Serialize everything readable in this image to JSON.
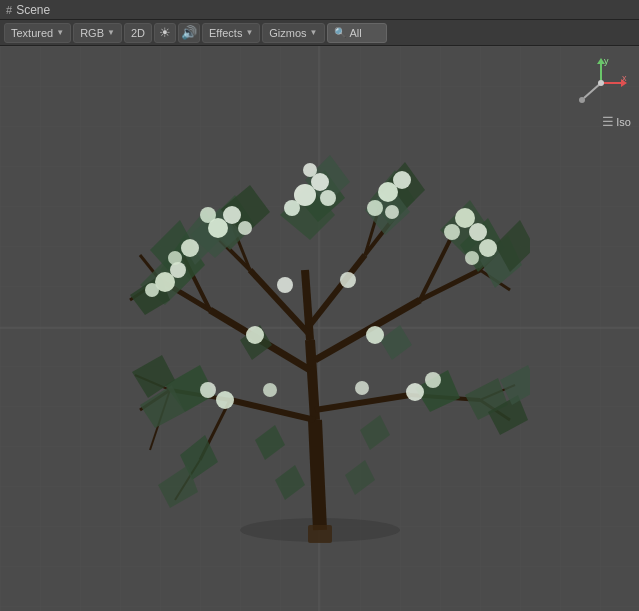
{
  "titleBar": {
    "icon": "#",
    "title": "Scene"
  },
  "toolbar": {
    "shadingMode": "Textured",
    "colorMode": "RGB",
    "drawMode": "2D",
    "lightIcon": "☀",
    "audioIcon": "🔊",
    "effects": "Effects",
    "gizmos": "Gizmos",
    "searchPrefix": "All",
    "searchPlaceholder": ""
  },
  "viewport": {
    "isoLabel": "Iso"
  },
  "colors": {
    "background": "#4a4a4a",
    "gridLine": "#555555",
    "titleBar": "#3c3c3c"
  }
}
